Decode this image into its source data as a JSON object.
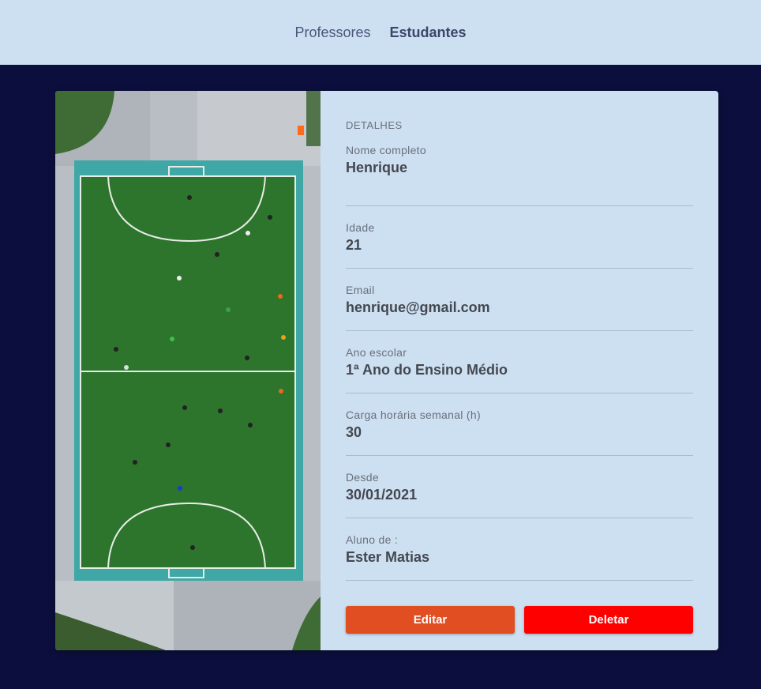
{
  "nav": {
    "items": [
      {
        "label": "Professores",
        "active": false
      },
      {
        "label": "Estudantes",
        "active": true
      }
    ]
  },
  "details": {
    "section_title": "DETALHES",
    "fields": [
      {
        "label": "Nome completo",
        "value": "Henrique"
      },
      {
        "label": "Idade",
        "value": "21"
      },
      {
        "label": "Email",
        "value": "henrique@gmail.com"
      },
      {
        "label": "Ano escolar",
        "value": "1ª Ano do Ensino Médio"
      },
      {
        "label": "Carga horária semanal (h)",
        "value": "30"
      },
      {
        "label": "Desde",
        "value": "30/01/2021"
      },
      {
        "label": "Aluno de :",
        "value": "Ester Matias"
      }
    ]
  },
  "actions": {
    "edit_label": "Editar",
    "delete_label": "Deletar"
  },
  "colors": {
    "page_bg": "#0c0f3e",
    "panel_bg": "#cce0f2",
    "edit": "#e04e21",
    "delete": "#ff0000"
  }
}
